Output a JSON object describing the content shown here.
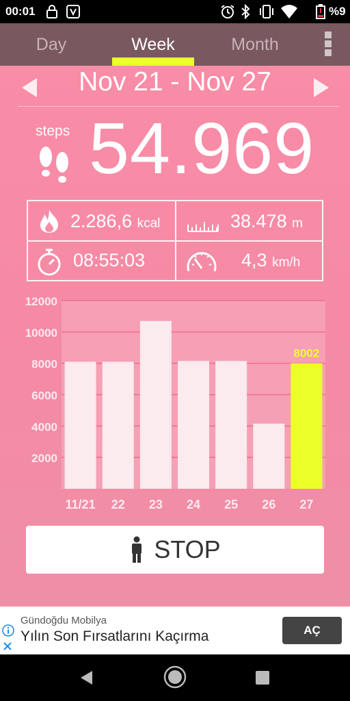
{
  "status_bar": {
    "time": "00:01",
    "battery": "%9"
  },
  "tabs": [
    {
      "label": "Day"
    },
    {
      "label": "Week"
    },
    {
      "label": "Month"
    }
  ],
  "active_tab": "Week",
  "date_range": "Nov 21 - Nov 27",
  "steps": {
    "label": "steps",
    "value": "54.969"
  },
  "stats": {
    "calories": {
      "value": "2.286,6",
      "unit": "kcal"
    },
    "distance": {
      "value": "38.478",
      "unit": "m"
    },
    "duration": {
      "value": "08:55:03"
    },
    "speed": {
      "value": "4,3",
      "unit": "km/h"
    }
  },
  "chart_data": {
    "type": "bar",
    "categories": [
      "11/21",
      "22",
      "23",
      "24",
      "25",
      "26",
      "27"
    ],
    "values": [
      8100,
      8100,
      10700,
      8150,
      8150,
      4150,
      8002
    ],
    "highlight_index": 6,
    "highlight_label": "8002",
    "ylim": [
      0,
      12000
    ],
    "yticks": [
      2000,
      4000,
      6000,
      8000,
      10000,
      12000
    ],
    "grid": true,
    "colors": {
      "bar": "#fbeaee",
      "highlight": "#ecff29",
      "grid": "#ef6d8a",
      "tick": "#ffeaf0"
    }
  },
  "stop_button": {
    "label": "STOP"
  },
  "ad": {
    "brand": "Gündoğdu Mobilya",
    "title": "Yılın Son Fırsatlarını Kaçırma",
    "cta": "AÇ"
  },
  "icons": {
    "status": [
      "lock-icon",
      "card-icon",
      "alarm-icon",
      "bluetooth-icon",
      "vibrate-icon",
      "wifi-icon",
      "battery-icon"
    ],
    "nav": [
      "back-icon",
      "home-icon",
      "recents-icon"
    ]
  }
}
